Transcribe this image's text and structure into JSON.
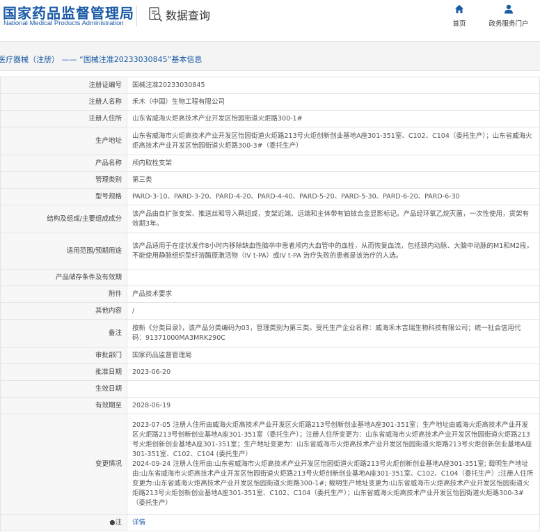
{
  "header": {
    "logo_cn": "国家药品监督管理局",
    "logo_en": "National Medical Products Administration",
    "query_title": "数据查询",
    "nav": [
      {
        "label": "首页",
        "icon": "home-icon"
      },
      {
        "label": "政务服务门户",
        "icon": "user-icon"
      }
    ]
  },
  "breadcrumb": "医疗器械（注册） —— “国械注准20233030845”基本信息",
  "colors": {
    "brand": "#1a5aa6",
    "label_bg": "#f7f7f7",
    "border": "#e4e4e4"
  },
  "rows": [
    {
      "label": "注册证编号",
      "value": "国械注准20233030845"
    },
    {
      "label": "注册人名称",
      "value": "禾木（中国）生物工程有限公司"
    },
    {
      "label": "注册人住所",
      "value": "山东省威海火炬高技术产业开发区怡园街道火炬路300-1#"
    },
    {
      "label": "生产地址",
      "value": "山东省威海市火炬高技术产业开发区怡园街道火炬路213号火炬创新创业基地A座301-351室、C102、C104（委托生产）；山东省威海火炬高技术产业开发区怡园街道火炬路300-3#（委托生产）"
    },
    {
      "label": "产品名称",
      "value": "颅内取栓支架"
    },
    {
      "label": "管理类别",
      "value": "第三类"
    },
    {
      "label": "型号规格",
      "value": "PARD-3-10、PARD-3-20、PARD-4-20、PARD-4-40、PARD-5-20、PARD-5-30、PARD-6-20、PARD-6-30"
    },
    {
      "label": "结构及组成/主要组成成分",
      "value": "该产品由自扩张支架、推送丝和导入鞘组成，支架近端、远端和主体带有铂铱合金显影标记。产品经环氧乙烷灭菌，一次性使用，货架有效期3年。"
    },
    {
      "label": "适用范围/预期用途",
      "value": "该产品适用于在症状发作8小时内移除缺血性脑卒中患者颅内大血管中的血栓，从而恢复血流，包括颈内动脉、大脑中动脉的M1和M2段。不能使用静脉组织型纤溶酶原激活物（IV t-PA）或IV t-PA 治疗失败的患者是该治疗的人选。"
    },
    {
      "label": "产品储存条件及有效期",
      "value": ""
    },
    {
      "label": "附件",
      "value": "产品技术要求"
    },
    {
      "label": "其他内容",
      "value": "/"
    },
    {
      "label": "备注",
      "value": "按新《分类目录》，该产品分类编码为03，管理类别为第三类。受托生产企业名称：威海禾木吉瑞生物科技有限公司；统一社会信用代码：91371000MA3MRK290C"
    },
    {
      "label": "审批部门",
      "value": "国家药品监督管理局"
    },
    {
      "label": "批准日期",
      "value": "2023-06-20"
    },
    {
      "label": "生效日期",
      "value": ""
    },
    {
      "label": "有效期至",
      "value": "2028-06-19"
    },
    {
      "label": "变更情况",
      "value": "2023-07-05 注册人住所由威海火炬高技术产业开发区火炬路213号创新创业基地A座301-351室；生产地址由威海火炬高技术产业开发区火炬路213号创新创业基地A座301-351室（委托生产）；注册人住所变更为：山东省威海市火炬高技术产业开发区怡园街道火炬路213号火炬创新创业基地A座301-351室；生产地址变更为：山东省威海市火炬高技术产业开发区怡园街道火炬路213号火炬创新创业基地A座301-351室、C102、C104 (委托生产）\n2024-09-24 注册人住所由:山东省威海市火炬高技术产业开发区怡园街道火炬路213号火炬创新创业基地A座301-351室; 载明生产地址由:山东省威海市火炬高技术产业开发区怡园街道火炬路213号火炬创新创业基地A座301-351室、C102、C104（委托生产）;注册人住所变更为:山东省威海火炬高技术产业开发区怡园街道火炬路300-1#; 载明生产地址变更为:山东省威海市火炬高技术产业开发区怡园街道火炬路213号火炬创新创业基地A座301-351室、C102、C104（委托生产）；山东省威海火炬高技术产业开发区怡园街道火炬路300-3#（委托生产）"
    },
    {
      "label": "●注",
      "value": "详情"
    }
  ]
}
